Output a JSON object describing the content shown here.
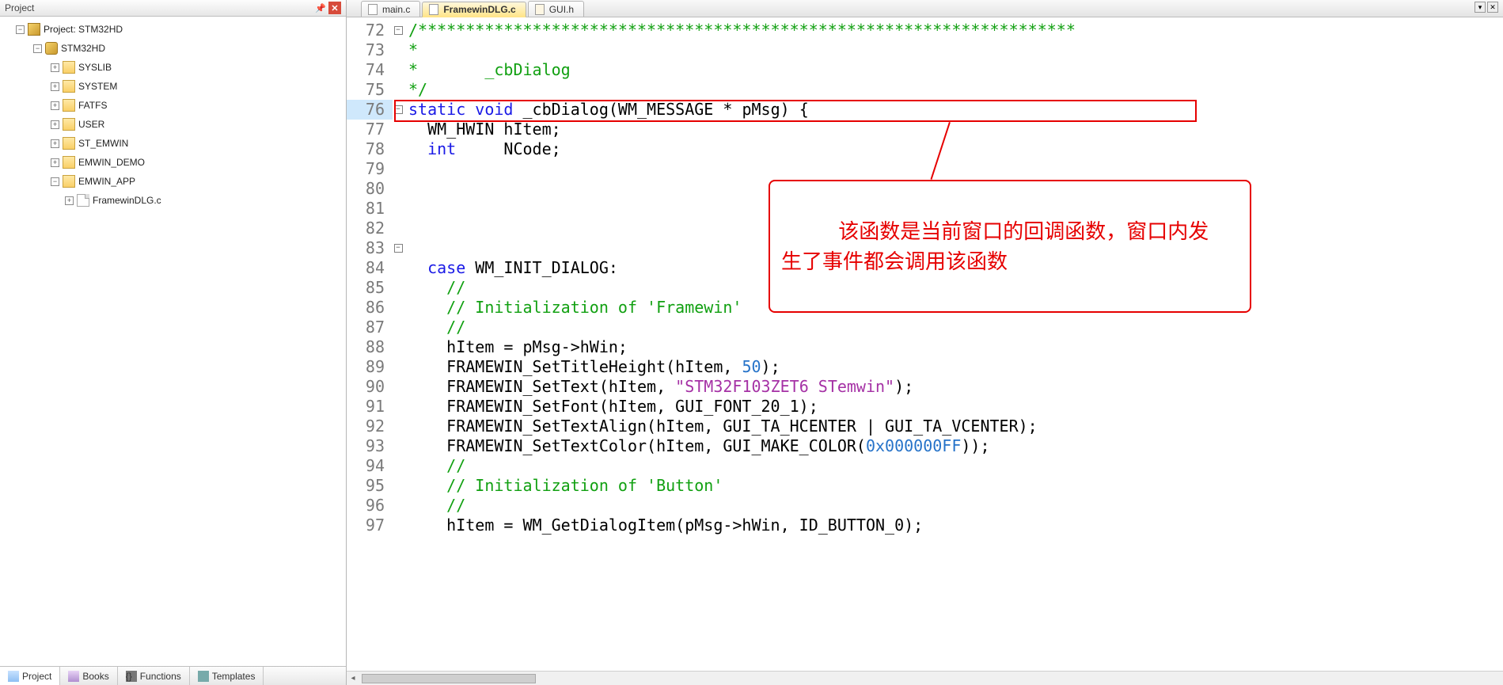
{
  "project_panel": {
    "title": "Project",
    "tree": {
      "root_label": "Project: STM32HD",
      "target_label": "STM32HD",
      "folders": [
        {
          "label": "SYSLIB"
        },
        {
          "label": "SYSTEM"
        },
        {
          "label": "FATFS"
        },
        {
          "label": "USER"
        },
        {
          "label": "ST_EMWIN"
        },
        {
          "label": "EMWIN_DEMO"
        },
        {
          "label": "EMWIN_APP",
          "expanded": true,
          "children": [
            {
              "label": "FramewinDLG.c"
            }
          ]
        }
      ]
    },
    "bottom_tabs": [
      {
        "label": "Project",
        "active": true
      },
      {
        "label": "Books"
      },
      {
        "label": "Functions"
      },
      {
        "label": "Templates"
      }
    ]
  },
  "editor": {
    "tabs": [
      {
        "label": "main.c",
        "active": false
      },
      {
        "label": "FramewinDLG.c",
        "active": true
      },
      {
        "label": "GUI.h",
        "active": false
      }
    ],
    "first_line_no": 72,
    "highlight_line_no": 76,
    "lines": [
      {
        "tokens": [
          {
            "t": "/*********************************************************************",
            "c": "cmt"
          }
        ]
      },
      {
        "tokens": [
          {
            "t": "*",
            "c": "cmt"
          }
        ]
      },
      {
        "tokens": [
          {
            "t": "*",
            "c": "cmt"
          },
          {
            "t": "       _cbDialog",
            "c": "cmt"
          }
        ]
      },
      {
        "tokens": [
          {
            "t": "*/",
            "c": "cmt"
          }
        ]
      },
      {
        "tokens": [
          {
            "t": "static",
            "c": "kw"
          },
          {
            "t": " "
          },
          {
            "t": "void",
            "c": "kw"
          },
          {
            "t": " _cbDialog(WM_MESSAGE * pMsg) {"
          }
        ]
      },
      {
        "tokens": [
          {
            "t": "  WM_HWIN hItem;"
          }
        ]
      },
      {
        "tokens": [
          {
            "t": "  "
          },
          {
            "t": "int",
            "c": "kw"
          },
          {
            "t": "     NCode;"
          }
        ]
      },
      {
        "tokens": [
          {
            "t": ""
          }
        ]
      },
      {
        "tokens": [
          {
            "t": ""
          }
        ]
      },
      {
        "tokens": [
          {
            "t": ""
          }
        ]
      },
      {
        "tokens": [
          {
            "t": ""
          }
        ]
      },
      {
        "tokens": [
          {
            "t": ""
          }
        ]
      },
      {
        "tokens": [
          {
            "t": "  "
          },
          {
            "t": "case",
            "c": "kw"
          },
          {
            "t": " WM_INIT_DIALOG:"
          }
        ]
      },
      {
        "tokens": [
          {
            "t": "    "
          },
          {
            "t": "//",
            "c": "cmt"
          }
        ]
      },
      {
        "tokens": [
          {
            "t": "    "
          },
          {
            "t": "// Initialization of 'Framewin'",
            "c": "cmt"
          }
        ]
      },
      {
        "tokens": [
          {
            "t": "    "
          },
          {
            "t": "//",
            "c": "cmt"
          }
        ]
      },
      {
        "tokens": [
          {
            "t": "    hItem = pMsg->hWin;"
          }
        ]
      },
      {
        "tokens": [
          {
            "t": "    FRAMEWIN_SetTitleHeight(hItem, "
          },
          {
            "t": "50",
            "c": "num"
          },
          {
            "t": ");"
          }
        ]
      },
      {
        "tokens": [
          {
            "t": "    FRAMEWIN_SetText(hItem, "
          },
          {
            "t": "\"STM32F103ZET6 STemwin\"",
            "c": "str"
          },
          {
            "t": ");"
          }
        ]
      },
      {
        "tokens": [
          {
            "t": "    FRAMEWIN_SetFont(hItem, GUI_FONT_20_1);"
          }
        ]
      },
      {
        "tokens": [
          {
            "t": "    FRAMEWIN_SetTextAlign(hItem, GUI_TA_HCENTER | GUI_TA_VCENTER);"
          }
        ]
      },
      {
        "tokens": [
          {
            "t": "    FRAMEWIN_SetTextColor(hItem, GUI_MAKE_COLOR("
          },
          {
            "t": "0x000000FF",
            "c": "num"
          },
          {
            "t": "));"
          }
        ]
      },
      {
        "tokens": [
          {
            "t": "    "
          },
          {
            "t": "//",
            "c": "cmt"
          }
        ]
      },
      {
        "tokens": [
          {
            "t": "    "
          },
          {
            "t": "// Initialization of 'Button'",
            "c": "cmt"
          }
        ]
      },
      {
        "tokens": [
          {
            "t": "    "
          },
          {
            "t": "//",
            "c": "cmt"
          }
        ]
      },
      {
        "tokens": [
          {
            "t": "    hItem = WM_GetDialogItem(pMsg->hWin, ID_BUTTON_0);"
          }
        ]
      }
    ],
    "annotation_text": "该函数是当前窗口的回调函数，窗口内发\n生了事件都会调用该函数"
  }
}
